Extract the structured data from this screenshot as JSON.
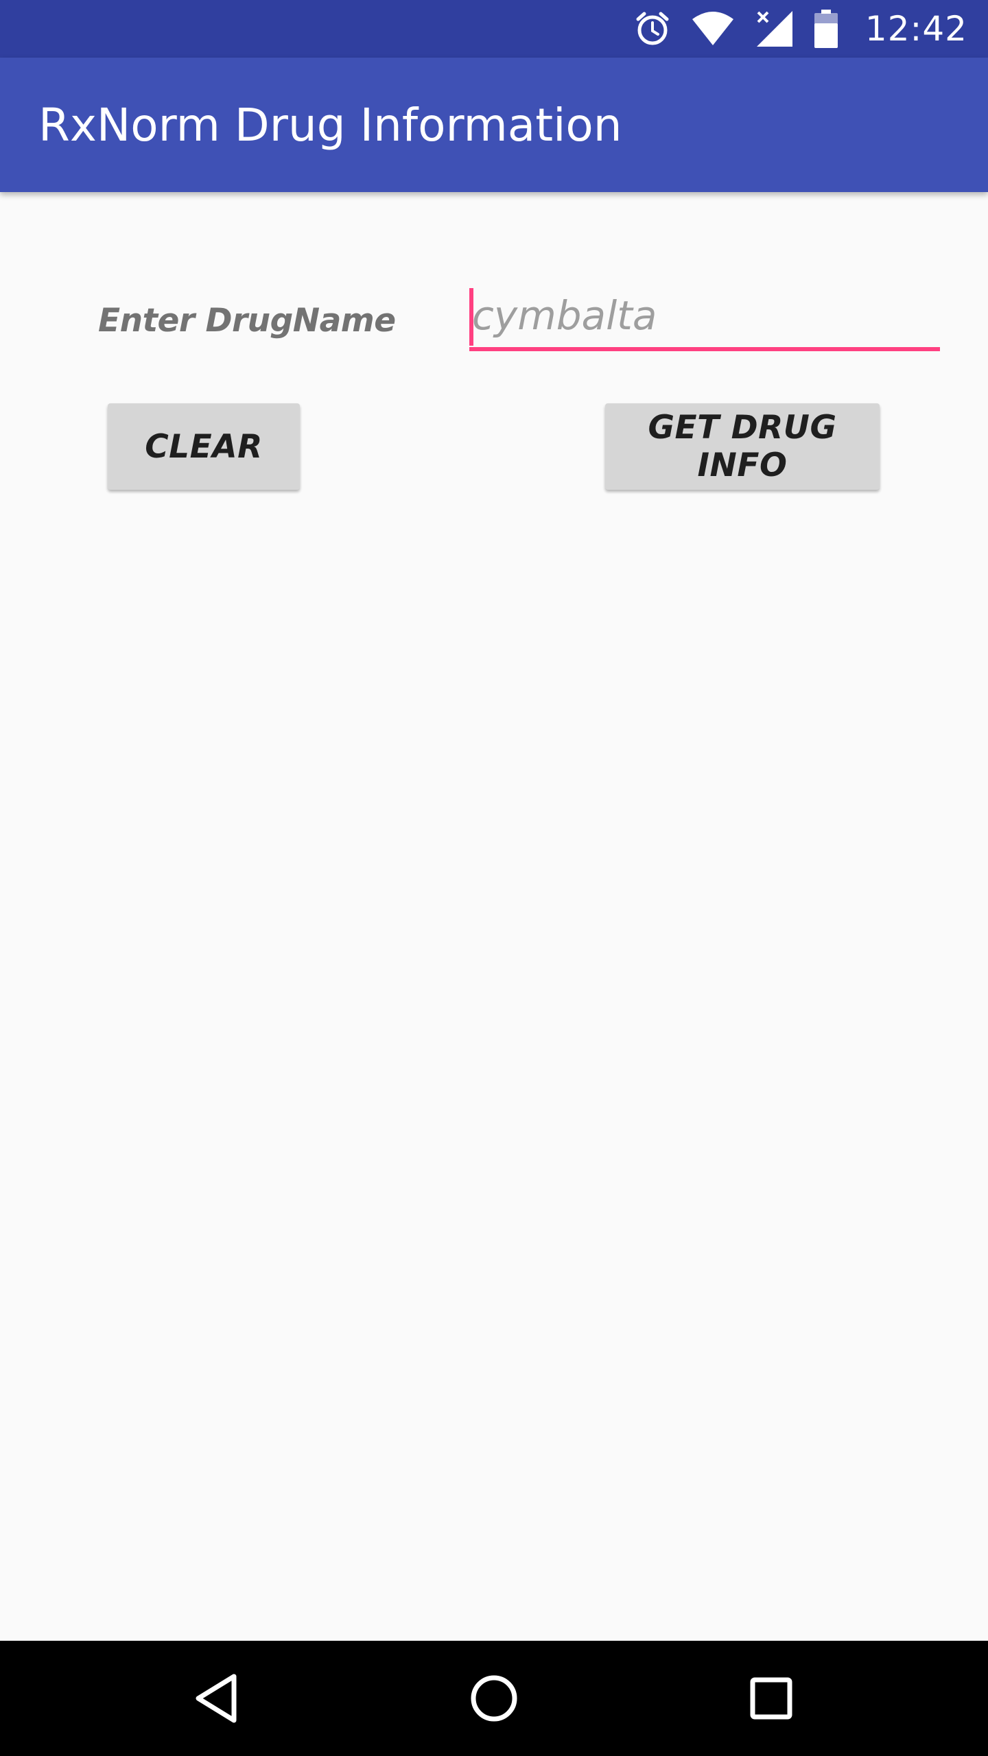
{
  "status_bar": {
    "time": "12:42",
    "icons": [
      "alarm-icon",
      "wifi-icon",
      "signal-icon",
      "battery-icon"
    ],
    "background": "#303f9f"
  },
  "app_bar": {
    "title": "RxNorm Drug Information",
    "background": "#3f51b5"
  },
  "form": {
    "label": "Enter DrugName",
    "input_value": "",
    "input_placeholder": "cymbalta",
    "accent_color": "#ff4081"
  },
  "buttons": {
    "clear_label": "CLEAR",
    "get_info_label": "GET DRUG INFO"
  },
  "nav_bar": {
    "icons": [
      "back-icon",
      "home-icon",
      "recents-icon"
    ]
  }
}
